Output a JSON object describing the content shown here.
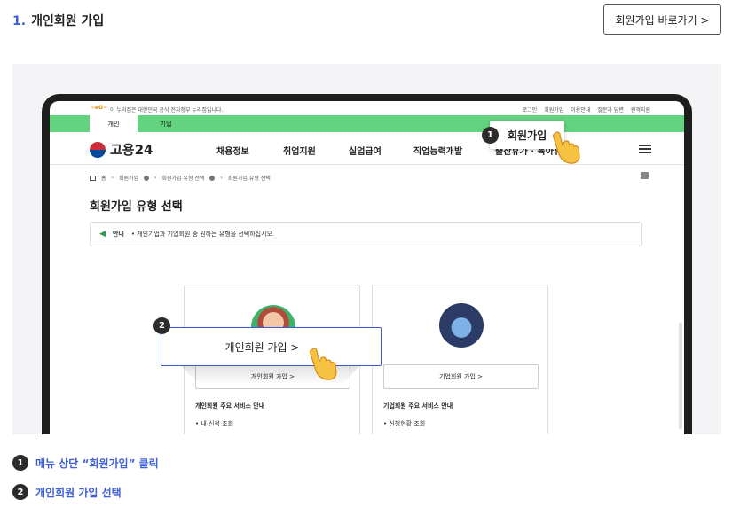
{
  "section": {
    "number": "1.",
    "title": "개인회원 가입"
  },
  "top_button": {
    "label": "회원가입 바로가기 >"
  },
  "site": {
    "gov_notice": "이 누리집은 대한민국 공식 전자정부 누리집입니다.",
    "gov_links": [
      "로그인",
      "회원가입",
      "이용안내",
      "질문과 답변",
      "원격지원"
    ],
    "tabs": [
      {
        "label": "개인",
        "active": true
      },
      {
        "label": "기업",
        "active": false
      }
    ],
    "logo": "고용24",
    "nav": [
      "채용정보",
      "취업지원",
      "실업급여",
      "직업능력개발",
      "출산휴가 · 육아휴"
    ],
    "breadcrumb": [
      "홈",
      "회원가입",
      "회원가입 유형 선택",
      "회원가입 유형 선택"
    ],
    "page_title": "회원가입 유형 선택",
    "notice_label": "안내",
    "notice_text": "• 개인기업과 기업회원 중 원하는 유형을 선택하십시오.",
    "cards": [
      {
        "button": "개인회원 가입 >",
        "services_title": "개인회원 주요 서비스 안내",
        "item": "• 내 신청 조회"
      },
      {
        "button": "기업회원 가입 >",
        "services_title": "기업회원 주요 서비스 안내",
        "item": "• 신청현황 조회"
      }
    ]
  },
  "callouts": [
    {
      "number": "1",
      "label": "회원가입"
    },
    {
      "number": "2",
      "label": "개인회원 가입  >"
    }
  ],
  "steps": [
    {
      "number": "1",
      "text": "메뉴 상단 “회원가입” 클릭"
    },
    {
      "number": "2",
      "text": "개인회원 가입 선택"
    }
  ],
  "colors": {
    "accent": "#3f5fd6",
    "green_bar": "#63d37f",
    "callout_border": "#3a5bd0"
  }
}
